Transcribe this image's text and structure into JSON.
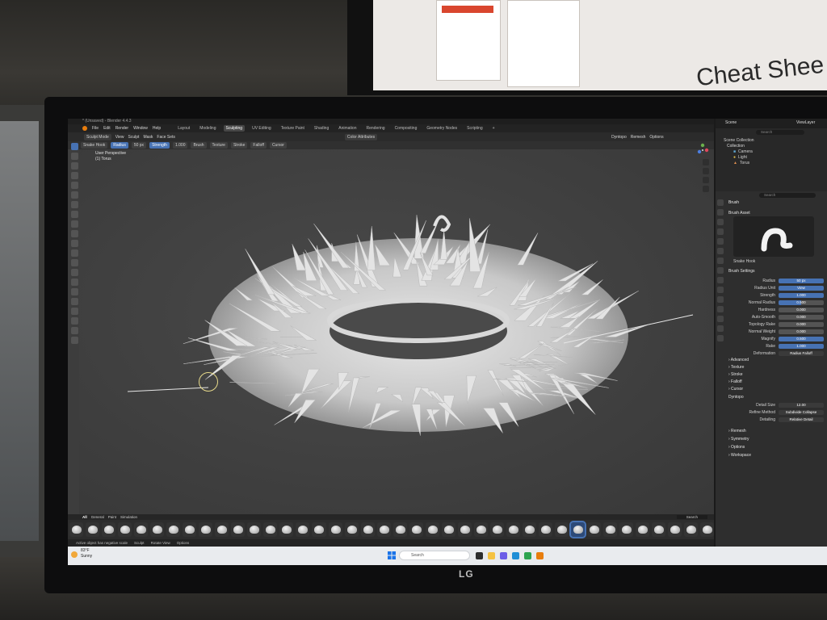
{
  "photo_backdrop": {
    "poster_title": "Cheat Shee",
    "monitor_brand": "LG"
  },
  "window": {
    "title": "* (Unsaved) - Blender 4.4.3"
  },
  "menu": {
    "items": [
      "File",
      "Edit",
      "Render",
      "Window",
      "Help"
    ],
    "workspaces": [
      "Layout",
      "Modeling",
      "Sculpting",
      "UV Editing",
      "Texture Paint",
      "Shading",
      "Animation",
      "Rendering",
      "Compositing",
      "Geometry Nodes",
      "Scripting"
    ],
    "active_workspace": "Sculpting",
    "add_tab": "+"
  },
  "header": {
    "mode": "Sculpt Mode",
    "menus": [
      "View",
      "Sculpt",
      "Mask",
      "Face Sets"
    ],
    "color_attributes": "Color Attributes",
    "dyntopo": "Dyntopo",
    "remesh": "Remesh",
    "options": "Options"
  },
  "tool_settings": {
    "brush": "Snake Hook",
    "radius_label": "Radius",
    "radius_value": "50 px",
    "strength_label": "Strength",
    "strength_value": "1.000",
    "dropdowns": [
      "Brush",
      "Texture",
      "Stroke",
      "Falloff",
      "Cursor"
    ]
  },
  "viewport": {
    "view_name": "User Perspective",
    "object_name": "(1) Torus",
    "search_placeholder": "Search"
  },
  "scene_selector": {
    "scene": "Scene",
    "view_layer": "ViewLayer"
  },
  "outliner": {
    "search_placeholder": "Search",
    "root": "Scene Collection",
    "collection": "Collection",
    "objects": [
      "Camera",
      "Light",
      "Torus"
    ]
  },
  "properties": {
    "search_placeholder": "Search",
    "context": "Brush",
    "brush_asset_section": "Brush Asset",
    "brush_name": "Snake Hook",
    "brush_settings_section": "Brush Settings",
    "fields": [
      {
        "label": "Radius",
        "value": "50 px",
        "style": "blue"
      },
      {
        "label": "Radius Unit",
        "value": "View",
        "style": "blue"
      },
      {
        "label": "Strength",
        "value": "1.000",
        "style": "blue"
      },
      {
        "label": "Normal Radius",
        "value": "0.500",
        "style": "blue-half"
      },
      {
        "label": "Hardness",
        "value": "0.000",
        "style": "gray"
      },
      {
        "label": "Auto-Smooth",
        "value": "0.000",
        "style": "gray"
      },
      {
        "label": "Topology Rake",
        "value": "0.000",
        "style": "gray"
      },
      {
        "label": "Normal Weight",
        "value": "0.000",
        "style": "gray"
      },
      {
        "label": "Magnify",
        "value": "0.500",
        "style": "blue"
      },
      {
        "label": "Rake",
        "value": "1.000",
        "style": "blue"
      },
      {
        "label": "Deformation",
        "value": "Radius Falloff",
        "style": "dropdown"
      }
    ],
    "collapsed_sections": [
      "Advanced",
      "Texture",
      "Stroke",
      "Falloff",
      "Cursor"
    ],
    "dyntopo_section": "Dyntopo",
    "dyntopo_fields": [
      {
        "label": "Detail Size",
        "value": "12.00"
      },
      {
        "label": "Refine Method",
        "value": "Subdivide Collapse"
      },
      {
        "label": "Detailing",
        "value": "Relative Detail"
      }
    ],
    "bottom_sections": [
      "Remesh",
      "Symmetry",
      "Options",
      "Workspace"
    ]
  },
  "asset_shelf": {
    "tabs": [
      "All",
      "General",
      "Paint",
      "Simulation"
    ],
    "active_tab": "All",
    "search_placeholder": "Search",
    "brush_count": 40,
    "active_index": 31
  },
  "status_bar": {
    "warning": "Active object has negative scale",
    "sculpt": "Sculpt",
    "rotate_view": "Rotate View",
    "options": "Options"
  },
  "taskbar": {
    "weather_temp": "83°F",
    "weather_desc": "Sunny",
    "search_placeholder": "Search"
  },
  "colors": {
    "accent_blue": "#4772b3",
    "viewport_bg": "#3f3f3f",
    "panel_bg": "#2e2e2e",
    "taskbar_bg": "#e9ebee"
  }
}
